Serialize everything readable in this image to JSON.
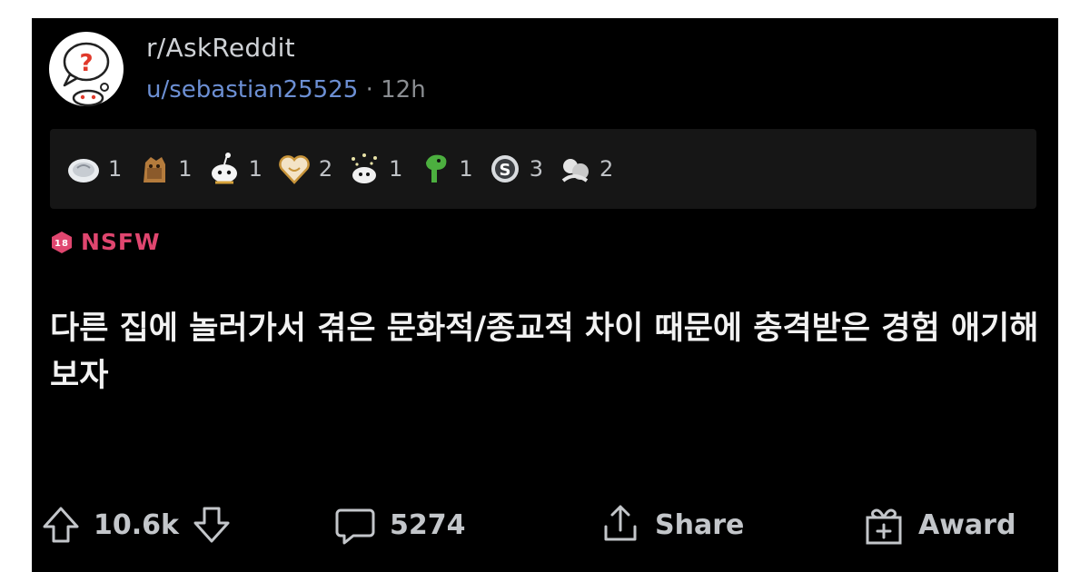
{
  "post": {
    "subreddit": "r/AskReddit",
    "author": "u/sebastian25525",
    "separator": "·",
    "time": "12h",
    "nsfw_label": "NSFW",
    "nsfw_badge_text": "18",
    "title": "다른 집에 놀러가서 겪은 문화적/종교적 차이 때문에 충격받은 경험 애기해보자"
  },
  "awards": [
    {
      "icon": "silver-award-icon",
      "count": "1"
    },
    {
      "icon": "doge-award-icon",
      "count": "1"
    },
    {
      "icon": "snoo-award-icon",
      "count": "1"
    },
    {
      "icon": "heart-award-icon",
      "count": "2"
    },
    {
      "icon": "party-award-icon",
      "count": "1"
    },
    {
      "icon": "dinosaur-award-icon",
      "count": "1"
    },
    {
      "icon": "coin-award-icon",
      "count": "3"
    },
    {
      "icon": "hug-award-icon",
      "count": "2"
    }
  ],
  "actions": {
    "votes": "10.6k",
    "comments": "5274",
    "share": "Share",
    "award": "Award"
  },
  "colors": {
    "background": "#000000",
    "username": "#6c8fd3",
    "nsfw": "#e0466f",
    "text": "#f2f2f2"
  }
}
